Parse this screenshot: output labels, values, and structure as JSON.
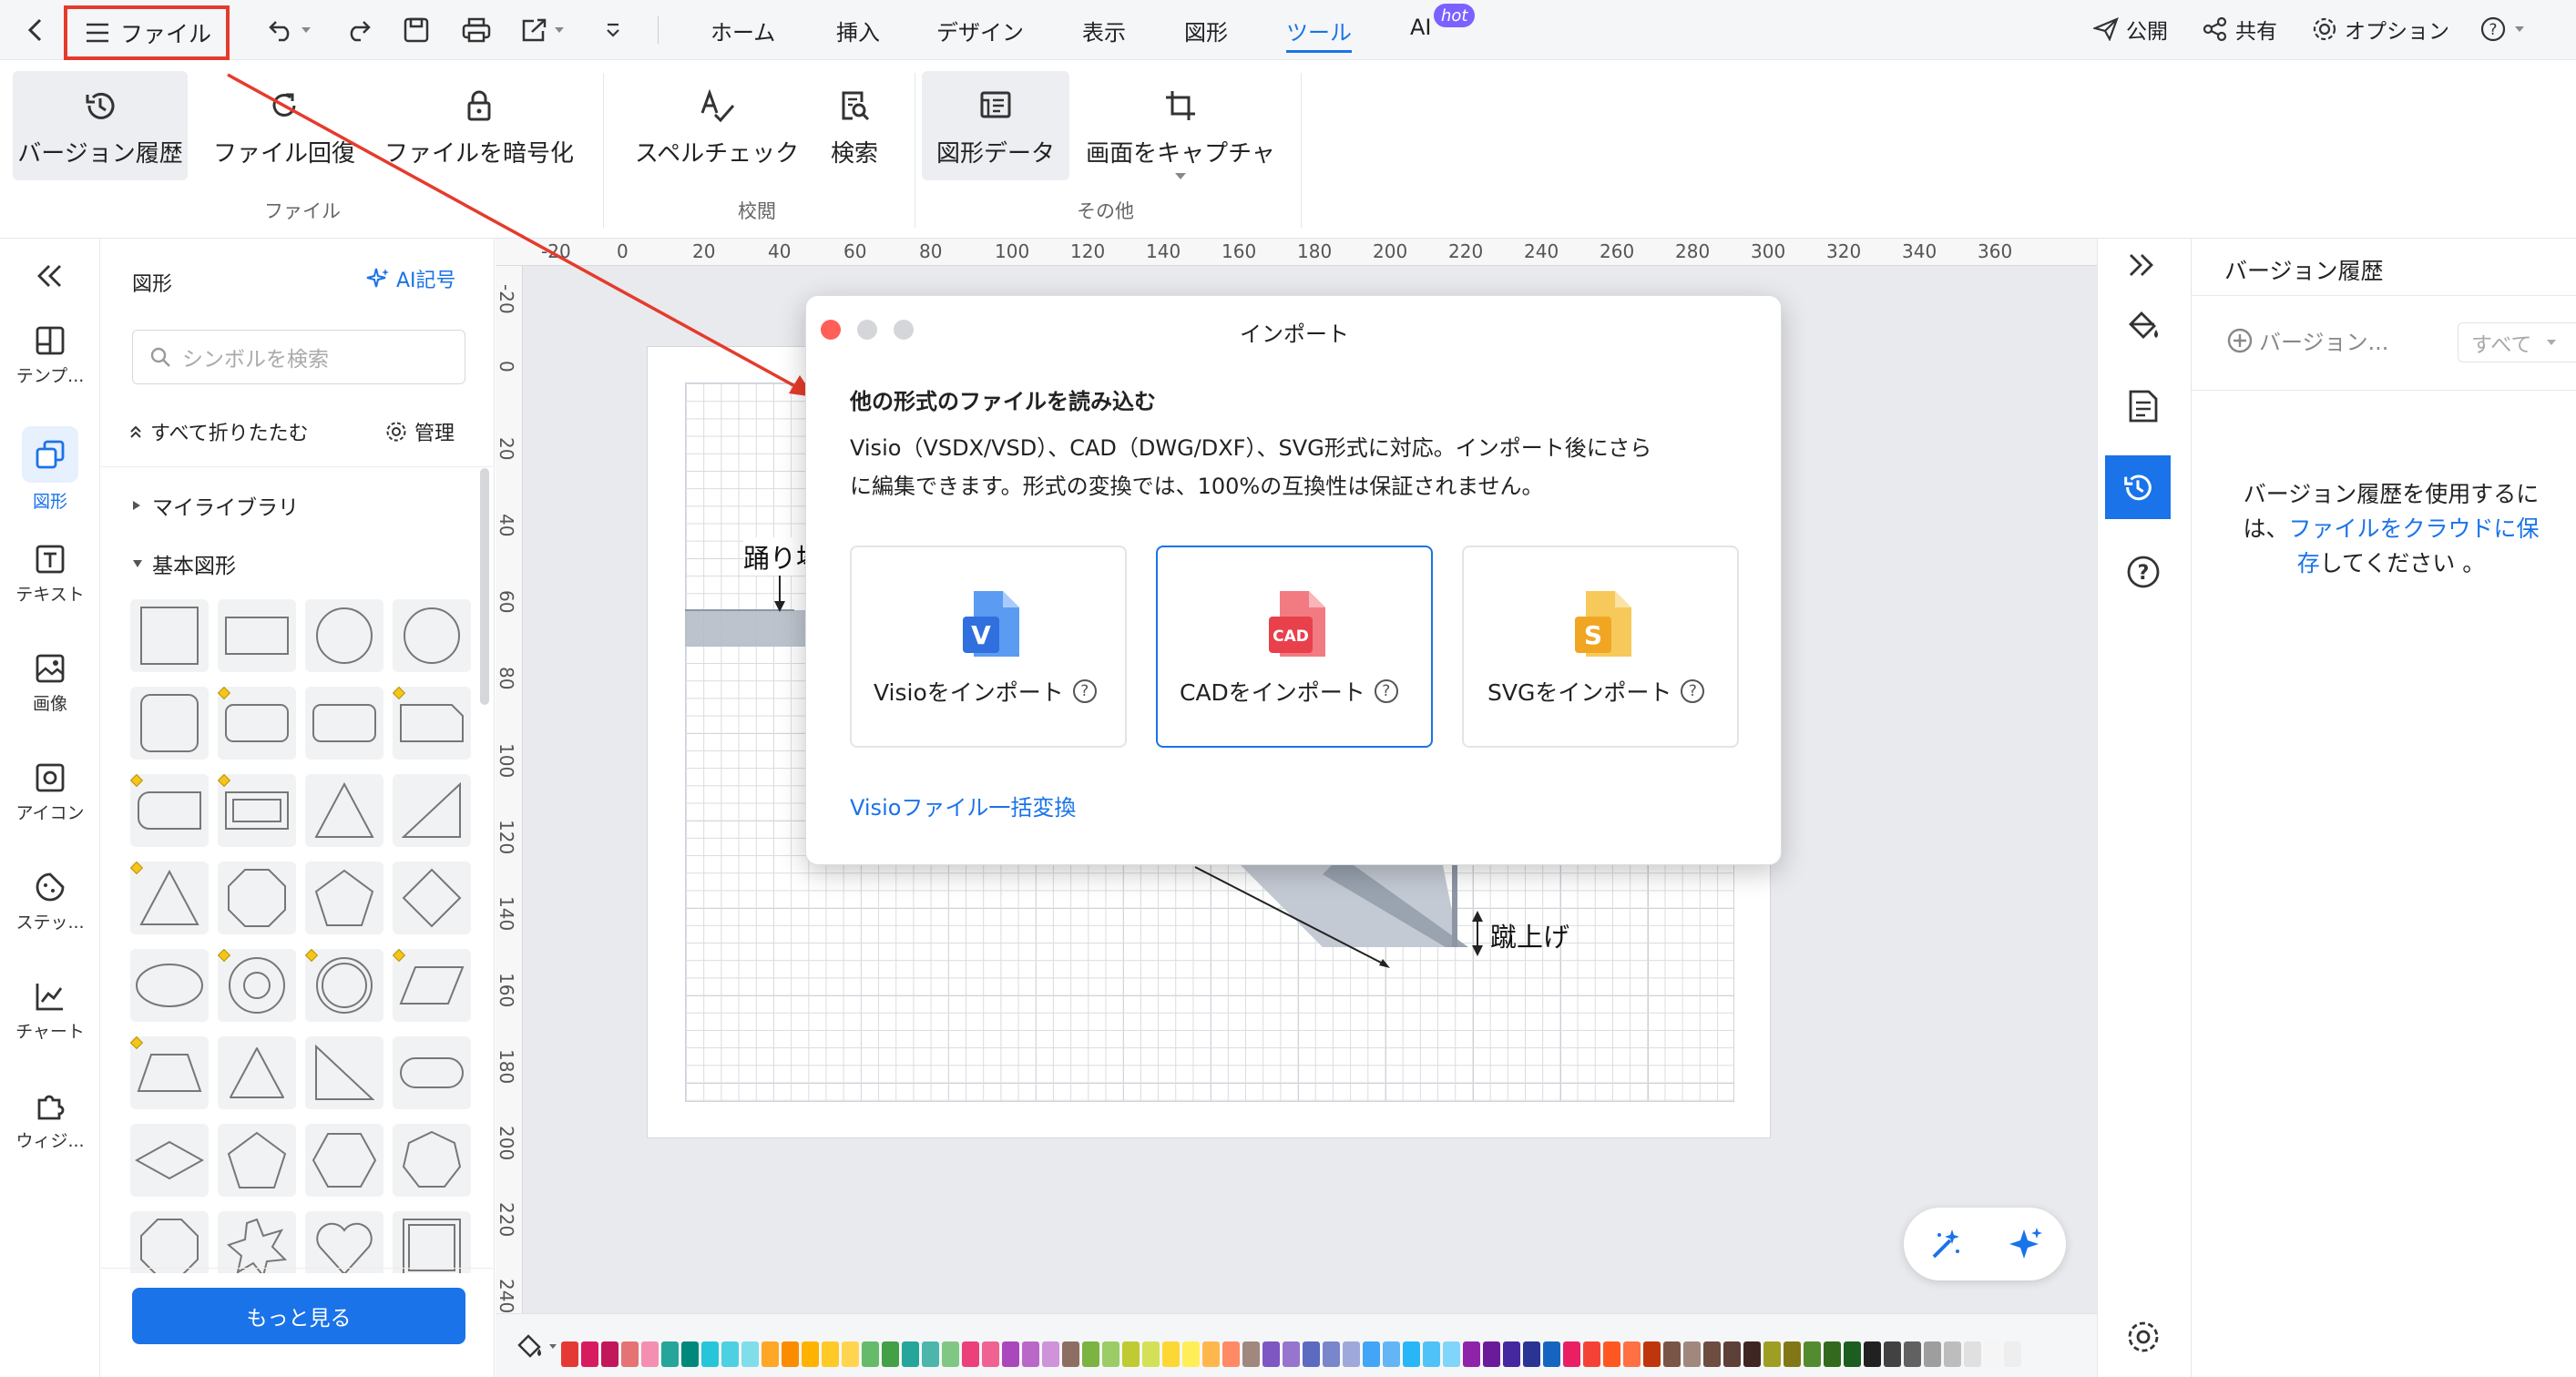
{
  "topbar": {
    "file_label": "ファイル",
    "tabs": [
      "ホーム",
      "挿入",
      "デザイン",
      "表示",
      "図形",
      "ツール",
      "AI"
    ],
    "active_tab": "ツール",
    "ai_badge": "hot",
    "publish": "公開",
    "share": "共有",
    "options": "オプション"
  },
  "ribbon": {
    "buttons": [
      "バージョン履歴",
      "ファイル回復",
      "ファイルを暗号化",
      "スペルチェック",
      "検索",
      "図形データ",
      "画面をキャプチャ"
    ],
    "groups": [
      "ファイル",
      "校閲",
      "その他"
    ]
  },
  "rail": {
    "items": [
      "テンプ...",
      "図形",
      "テキスト",
      "画像",
      "アイコン",
      "ステッ...",
      "チャート",
      "ウィジ..."
    ]
  },
  "panel": {
    "title": "図形",
    "ai_symbol": "AI記号",
    "search_placeholder": "シンボルを検索",
    "collapse_all": "すべて折りたたむ",
    "manage": "管理",
    "my_library": "マイライブラリ",
    "basic_shapes": "基本図形",
    "more": "もっと見る"
  },
  "ruler": {
    "top": [
      "-20",
      "0",
      "20",
      "40",
      "60",
      "80",
      "100",
      "120",
      "140",
      "160",
      "180",
      "200",
      "220",
      "240",
      "260",
      "280",
      "300",
      "320",
      "340",
      "360"
    ],
    "left": [
      "-20",
      "0",
      "20",
      "40",
      "60",
      "80",
      "100",
      "120",
      "140",
      "160",
      "180",
      "200",
      "220",
      "240"
    ]
  },
  "canvas": {
    "label_landing": "踊り場",
    "label_riser": "蹴上げ"
  },
  "dialog": {
    "title": "インポート",
    "heading": "他の形式のファイルを読み込む",
    "body_line1": "Visio（VSDX/VSD）、CAD（DWG/DXF）、SVG形式に対応。インポート後にさら",
    "body_line2": "に編集できます。形式の変換では、100%の互換性は保証されません。",
    "cards": [
      {
        "label": "Visioをインポート",
        "icon": "visio-file-icon",
        "letter": "V",
        "color": "#2f6fde"
      },
      {
        "label": "CADをインポート",
        "icon": "cad-file-icon",
        "letter": "CAD",
        "color": "#e8414c"
      },
      {
        "label": "SVGをインポート",
        "icon": "svg-file-icon",
        "letter": "S",
        "color": "#f0a623"
      }
    ],
    "batch_link": "Visioファイル一括変換",
    "help_mark": "?"
  },
  "right_panel": {
    "title": "バージョン履歴",
    "add_version": "バージョン...",
    "filter": "すべて",
    "msg_line1": "バージョン履歴を使用するに",
    "msg_line2_prefix": "は、",
    "msg_link_a": "ファイルをクラウドに保",
    "msg_link_b": "存",
    "msg_suffix": "してください 。"
  },
  "colors": {
    "accent": "#1a73e8",
    "annotation_red": "#e53b2c",
    "palette": [
      "#e53935",
      "#d81b60",
      "#c2185b",
      "#e57373",
      "#f48fb1",
      "#26a69a",
      "#00897b",
      "#26c6da",
      "#4dd0e1",
      "#80deea",
      "#ffa726",
      "#fb8c00",
      "#ffb300",
      "#ffca28",
      "#ffd54f",
      "#66bb6a",
      "#43a047",
      "#26a69a",
      "#4db6ac",
      "#81c784",
      "#ec407a",
      "#f06292",
      "#ab47bc",
      "#ba68c8",
      "#ce93d8",
      "#8d6e63",
      "#7cb342",
      "#9ccc65",
      "#c0ca33",
      "#d4e157",
      "#fdd835",
      "#ffee58",
      "#ffb74d",
      "#ff8a65",
      "#a1887f",
      "#7e57c2",
      "#9575cd",
      "#5c6bc0",
      "#7986cb",
      "#9fa8da",
      "#42a5f5",
      "#64b5f6",
      "#29b6f6",
      "#4fc3f7",
      "#81d4fa",
      "#8e24aa",
      "#6a1b9a",
      "#4527a0",
      "#283593",
      "#1565c0",
      "#e91e63",
      "#f44336",
      "#ff5722",
      "#ff7043",
      "#bf360c",
      "#795548",
      "#a1887f",
      "#6d4c41",
      "#5d4037",
      "#3e2723",
      "#9e9d24",
      "#827717",
      "#558b2f",
      "#33691e",
      "#1b5e20",
      "#212121",
      "#424242",
      "#616161",
      "#9e9e9e",
      "#bdbdbd",
      "#e0e0e0",
      "#f5f5f5",
      "#eeeeee"
    ]
  }
}
